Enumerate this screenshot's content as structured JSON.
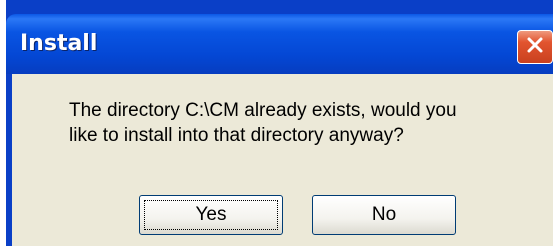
{
  "dialog": {
    "title": "Install",
    "message_lines": [
      "The directory C:\\CM already exists, would you",
      "like to install into that directory anyway?"
    ],
    "buttons": {
      "yes_label": "Yes",
      "no_label": "No"
    },
    "close_icon": "close-icon"
  },
  "colors": {
    "titlebar": "#0447d4",
    "client": "#ece9d8",
    "close": "#e2542f"
  }
}
